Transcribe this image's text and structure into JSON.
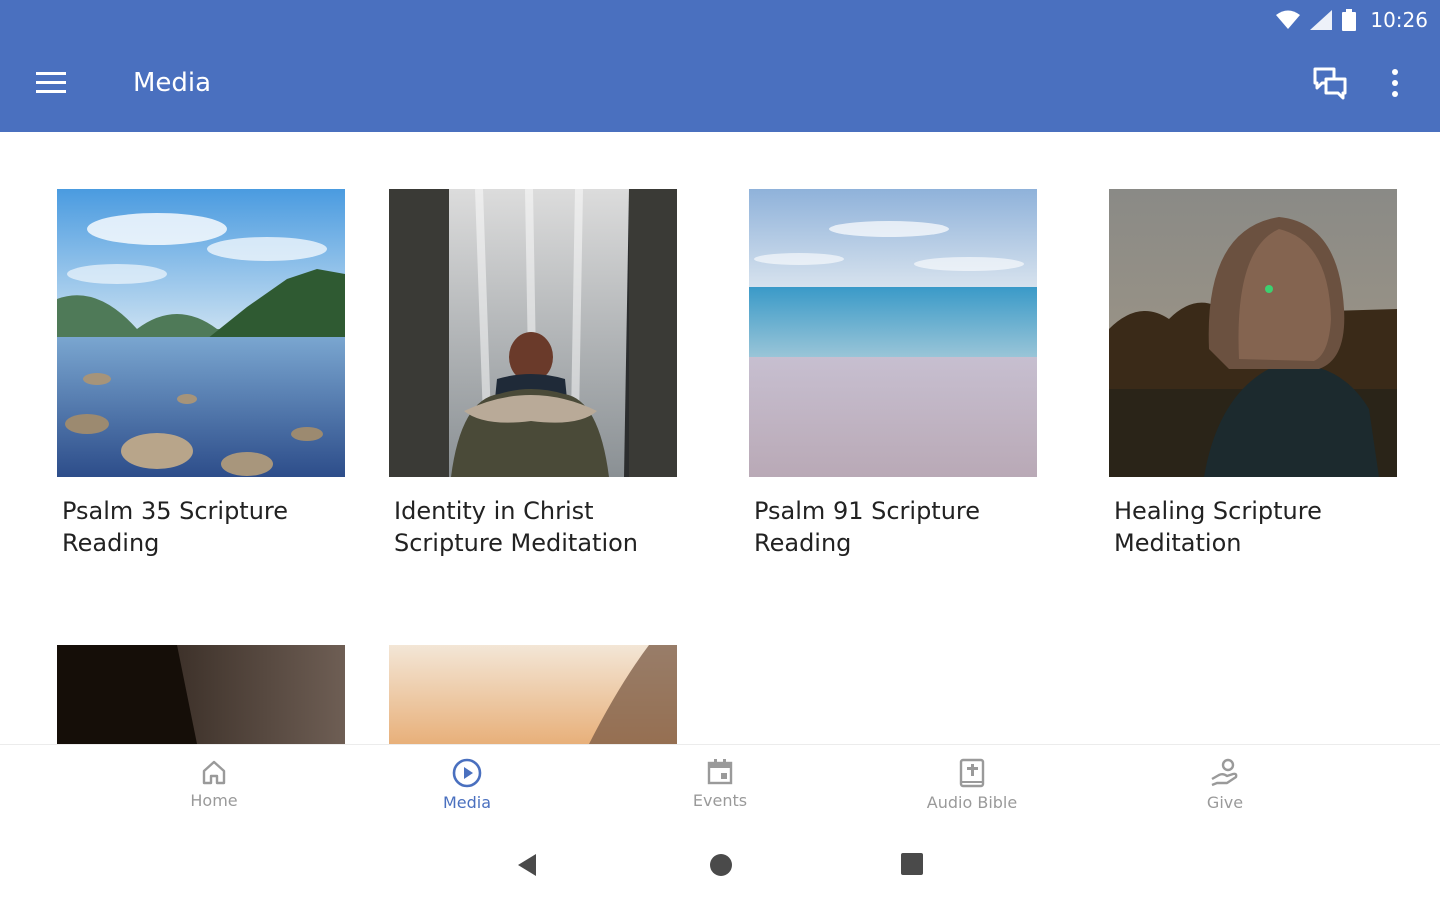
{
  "status_bar": {
    "time": "10:26"
  },
  "app_bar": {
    "title": "Media"
  },
  "media_items": [
    {
      "title": "Psalm 35 Scripture Reading"
    },
    {
      "title": "Identity in Christ Scripture Meditation"
    },
    {
      "title": "Psalm 91 Scripture Reading"
    },
    {
      "title": "Healing Scripture Meditation"
    }
  ],
  "bottom_nav": {
    "items": [
      {
        "label": "Home"
      },
      {
        "label": "Media"
      },
      {
        "label": "Events"
      },
      {
        "label": "Audio Bible"
      },
      {
        "label": "Give"
      }
    ],
    "active": "Media"
  },
  "colors": {
    "primary": "#4a70bf",
    "inactive": "#9a9a9a"
  }
}
